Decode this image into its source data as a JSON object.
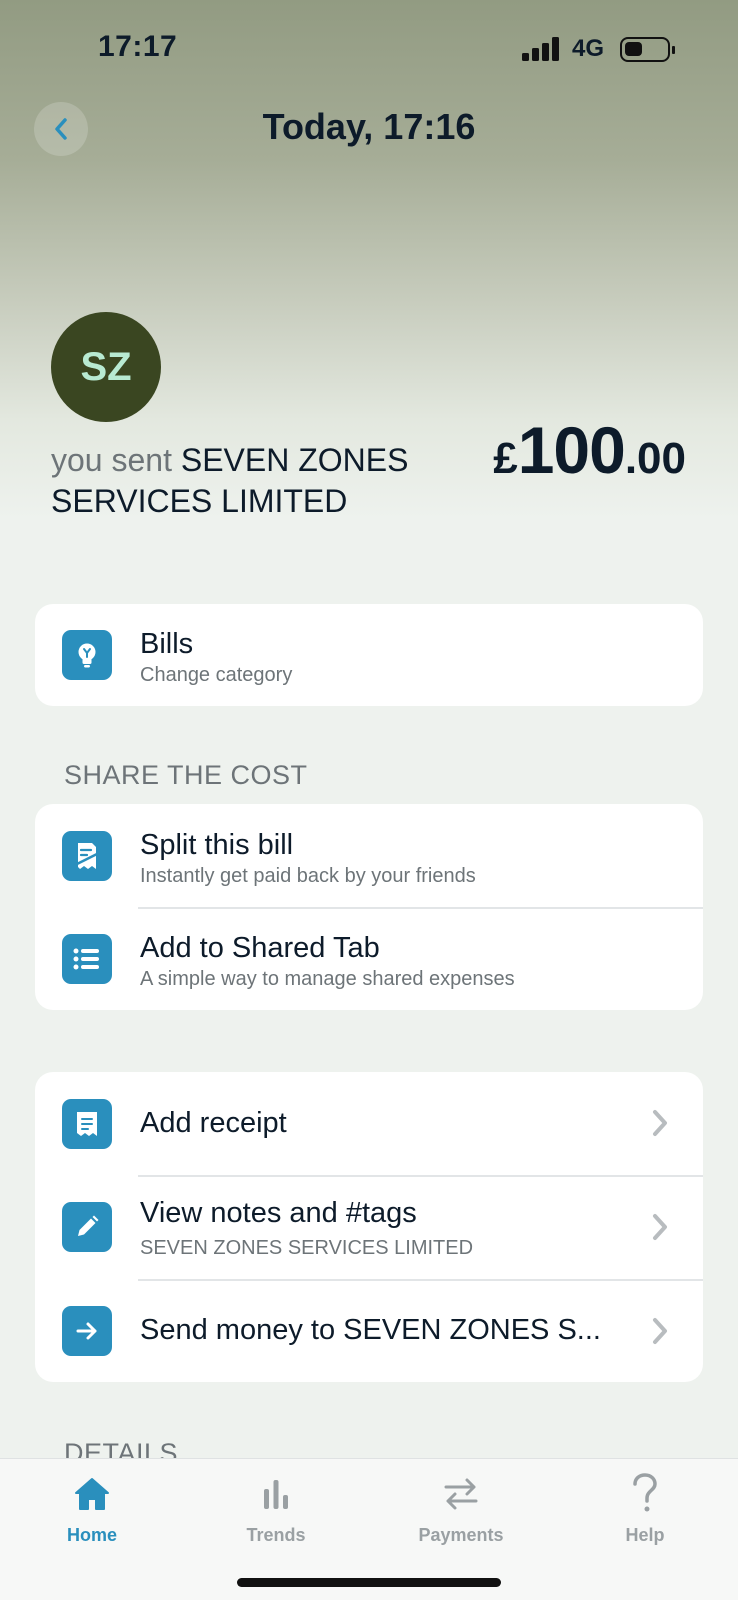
{
  "status_bar": {
    "time": "17:17",
    "network": "4G"
  },
  "header": {
    "title": "Today, 17:16",
    "back_icon": "chevron-left-icon"
  },
  "transaction": {
    "avatar_initials": "SZ",
    "prefix": "you sent",
    "merchant": "SEVEN ZONES SERVICES LIMITED",
    "amount_currency": "£",
    "amount_major": "100",
    "amount_minor": ".00"
  },
  "category": {
    "icon": "lightbulb-icon",
    "title": "Bills",
    "subtitle": "Change category"
  },
  "share": {
    "heading": "SHARE THE COST",
    "items": [
      {
        "icon": "receipt-split-icon",
        "title": "Split this bill",
        "subtitle": "Instantly get paid back by your friends"
      },
      {
        "icon": "list-icon",
        "title": "Add to Shared Tab",
        "subtitle": "A simple way to manage shared expenses"
      }
    ]
  },
  "actions": {
    "items": [
      {
        "icon": "receipt-icon",
        "title": "Add receipt"
      },
      {
        "icon": "pencil-icon",
        "title": "View notes and #tags",
        "subtitle": "SEVEN ZONES SERVICES LIMITED"
      },
      {
        "icon": "arrow-right-icon",
        "title": "Send money to SEVEN ZONES S..."
      }
    ]
  },
  "details_heading": "DETAILS",
  "tabbar": {
    "items": [
      {
        "label": "Home",
        "icon": "home-icon",
        "active": true
      },
      {
        "label": "Trends",
        "icon": "bar-chart-icon",
        "active": false
      },
      {
        "label": "Payments",
        "icon": "transfer-arrows-icon",
        "active": false
      },
      {
        "label": "Help",
        "icon": "question-icon",
        "active": false
      }
    ]
  },
  "colors": {
    "accent": "#2a8fbd",
    "avatar_bg": "#3a4621",
    "avatar_text": "#b8ead2",
    "text": "#0d1b2a",
    "muted": "#6d7478"
  }
}
